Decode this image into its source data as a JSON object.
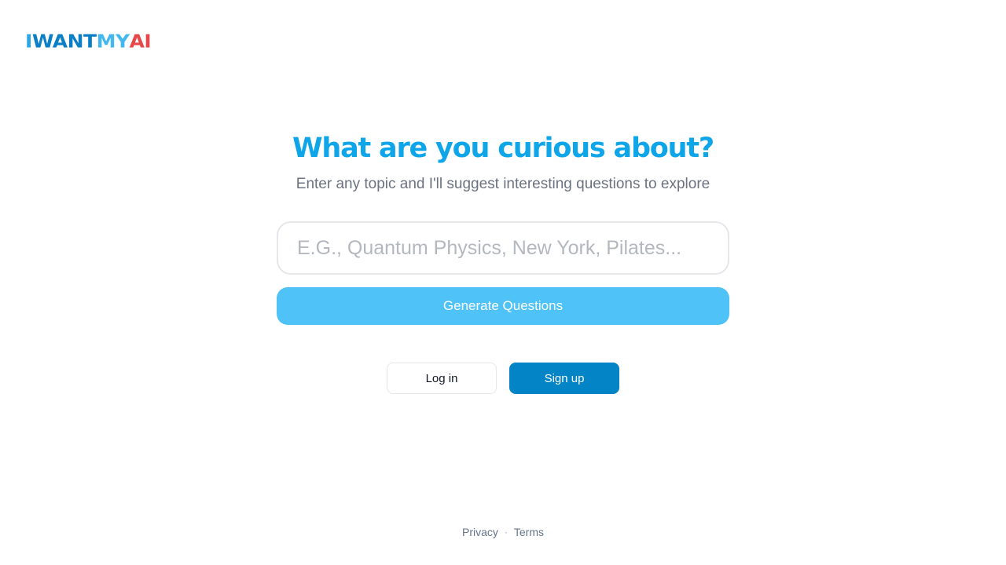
{
  "logo": {
    "parts": [
      "I",
      "WANT",
      "MY",
      "AI"
    ],
    "colors": {
      "i": "#2aa5e6",
      "want": "#0b7fc6",
      "my": "#43b8ef",
      "ai": "#e8474a"
    }
  },
  "hero": {
    "title": "What are you curious about?",
    "subtitle": "Enter any topic and I'll suggest interesting questions to explore"
  },
  "search": {
    "placeholder": "E.G., Quantum Physics, New York, Pilates...",
    "value": ""
  },
  "actions": {
    "generate_label": "Generate Questions",
    "login_label": "Log in",
    "signup_label": "Sign up"
  },
  "footer": {
    "privacy_label": "Privacy",
    "separator": "·",
    "terms_label": "Terms"
  },
  "theme": {
    "accent": "#0ea5e9",
    "generate_button": "#4fc3f7",
    "signup_button": "#0284c7"
  }
}
